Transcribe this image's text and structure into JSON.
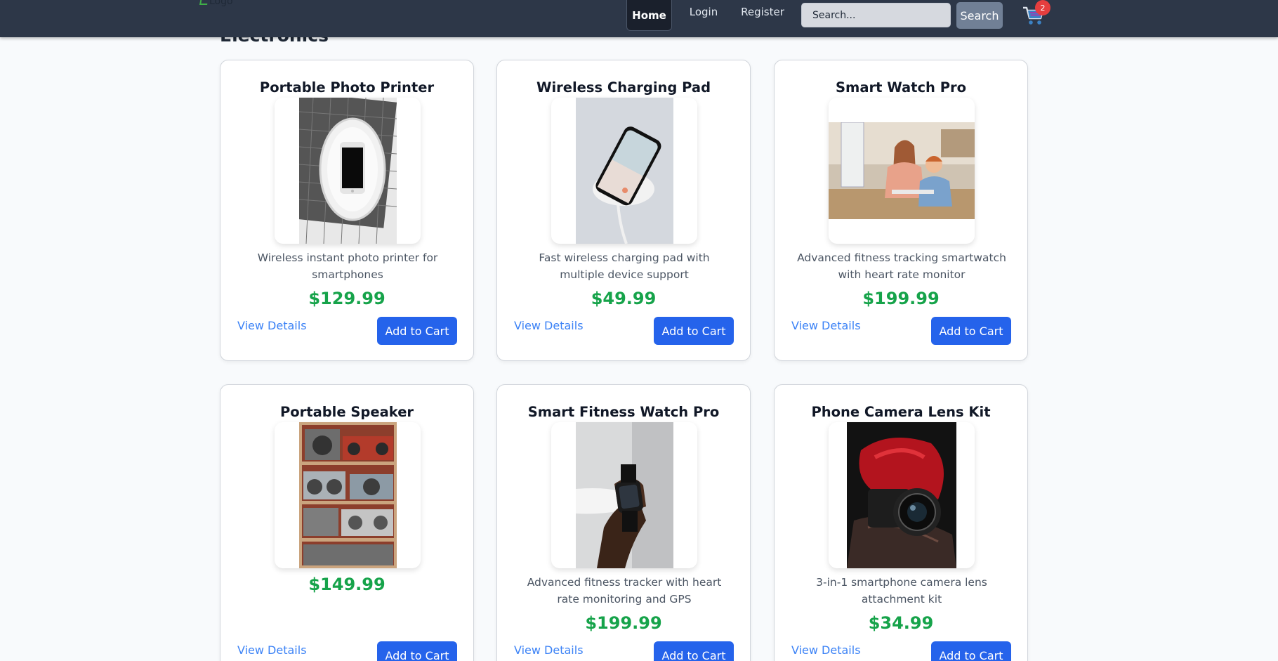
{
  "navbar": {
    "logo_alt": "Logo",
    "home_label": "Home",
    "login_label": "Login",
    "register_label": "Register",
    "search_placeholder": "Search...",
    "search_button_label": "Search",
    "cart_count": "2",
    "colors": {
      "bar": "#2d3748",
      "cart_badge": "#e53e3e"
    }
  },
  "category": {
    "title": "Electronics"
  },
  "colors": {
    "price": "#16a34a",
    "primary_button": "#2563eb",
    "link": "#3b82f6"
  },
  "products": [
    {
      "name": "Portable Photo Printer",
      "description": "Wireless instant photo printer for smartphones",
      "price": "$129.99",
      "view_label": "View Details",
      "add_label": "Add to Cart",
      "image": "phone-on-tray-photo"
    },
    {
      "name": "Wireless Charging Pad",
      "description": "Fast wireless charging pad with multiple device support",
      "price": "$49.99",
      "view_label": "View Details",
      "add_label": "Add to Cart",
      "image": "phone-on-charger-photo"
    },
    {
      "name": "Smart Watch Pro",
      "description": "Advanced fitness tracking smartwatch with heart rate monitor",
      "price": "$199.99",
      "view_label": "View Details",
      "add_label": "Add to Cart",
      "image": "people-at-computer-photo"
    },
    {
      "name": "Portable Speaker",
      "description": "",
      "price": "$149.99",
      "view_label": "View Details",
      "add_label": "Add to Cart",
      "image": "boombox-shelf-photo"
    },
    {
      "name": "Smart Fitness Watch Pro",
      "description": "Advanced fitness tracker with heart rate monitoring and GPS",
      "price": "$199.99",
      "view_label": "View Details",
      "add_label": "Add to Cart",
      "image": "wrist-watch-photo"
    },
    {
      "name": "Phone Camera Lens Kit",
      "description": "3-in-1 smartphone camera lens attachment kit",
      "price": "$34.99",
      "view_label": "View Details",
      "add_label": "Add to Cart",
      "image": "camera-bag-photo"
    }
  ]
}
